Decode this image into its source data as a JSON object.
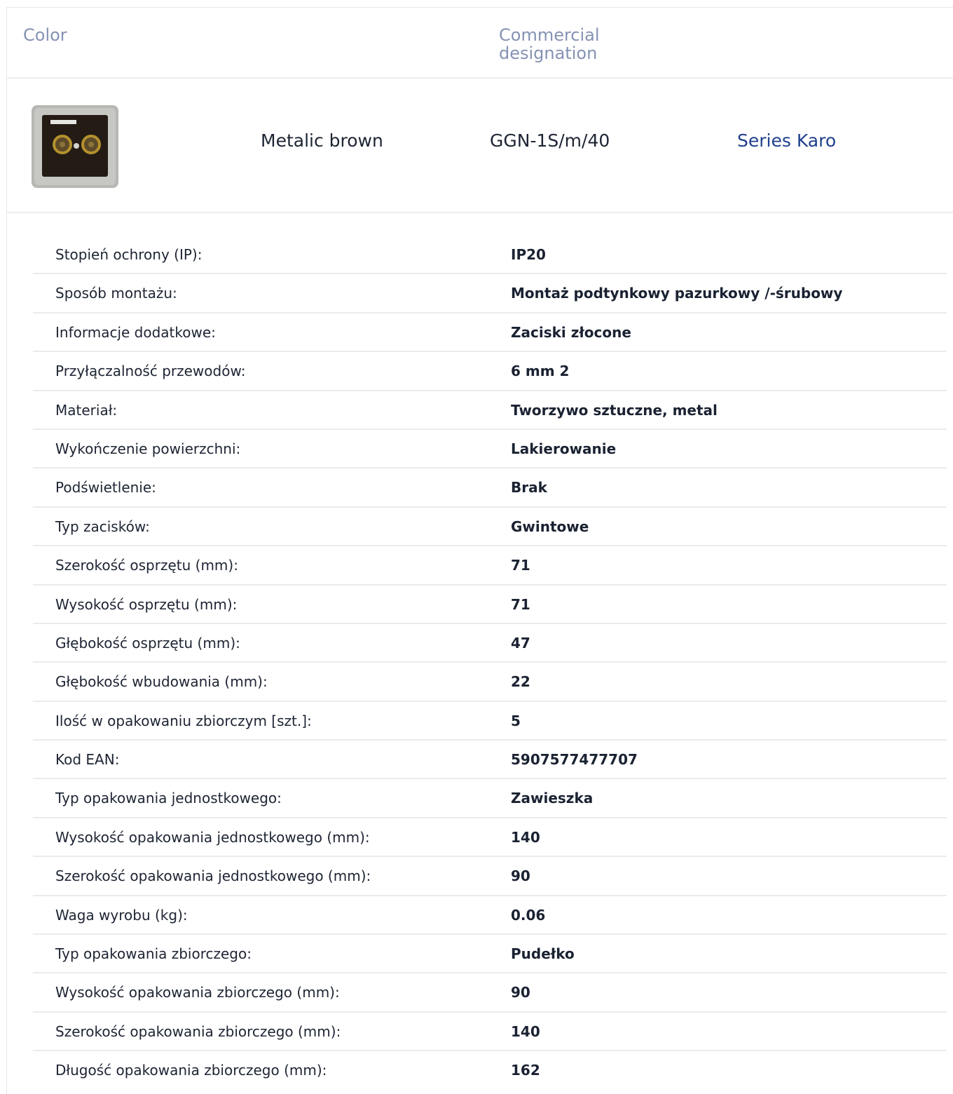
{
  "headers": {
    "color": "Color",
    "designation": "Commercial designation"
  },
  "product": {
    "image_icon": "metallic-brown-tv-socket-icon",
    "color": "Metalic brown",
    "code": "GGN-1S/m/40",
    "series": "Series Karo"
  },
  "colors": {
    "header_text": "#8592b3",
    "series_link": "#1f3f8c",
    "divider": "#e9ebee"
  },
  "specs": [
    {
      "label": "Stopień ochrony (IP):",
      "value": "IP20"
    },
    {
      "label": "Sposób montażu:",
      "value": "Montaż podtynkowy pazurkowy /-śrubowy"
    },
    {
      "label": "Informacje dodatkowe:",
      "value": "Zaciski złocone"
    },
    {
      "label": "Przyłączalność przewodów:",
      "value": "6 mm 2"
    },
    {
      "label": "Materiał:",
      "value": "Tworzywo sztuczne, metal"
    },
    {
      "label": "Wykończenie powierzchni:",
      "value": "Lakierowanie"
    },
    {
      "label": "Podświetlenie:",
      "value": "Brak"
    },
    {
      "label": "Typ zacisków:",
      "value": "Gwintowe"
    },
    {
      "label": "Szerokość osprzętu (mm):",
      "value": "71"
    },
    {
      "label": "Wysokość osprzętu (mm):",
      "value": "71"
    },
    {
      "label": "Głębokość osprzętu (mm):",
      "value": "47"
    },
    {
      "label": "Głębokość wbudowania (mm):",
      "value": "22"
    },
    {
      "label": "Ilość w opakowaniu zbiorczym [szt.]:",
      "value": "5"
    },
    {
      "label": "Kod EAN:",
      "value": "5907577477707"
    },
    {
      "label": "Typ opakowania jednostkowego:",
      "value": "Zawieszka"
    },
    {
      "label": "Wysokość opakowania jednostkowego (mm):",
      "value": "140"
    },
    {
      "label": "Szerokość opakowania jednostkowego (mm):",
      "value": "90"
    },
    {
      "label": "Waga wyrobu (kg):",
      "value": "0.06"
    },
    {
      "label": "Typ opakowania zbiorczego:",
      "value": "Pudełko"
    },
    {
      "label": "Wysokość opakowania zbiorczego (mm):",
      "value": "90"
    },
    {
      "label": "Szerokość opakowania zbiorczego (mm):",
      "value": "140"
    },
    {
      "label": "Długość opakowania zbiorczego (mm):",
      "value": "162"
    }
  ]
}
